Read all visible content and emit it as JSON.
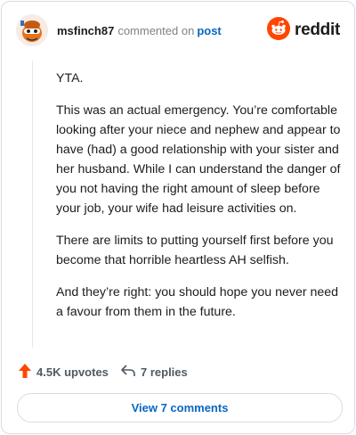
{
  "header": {
    "username": "msfinch87",
    "action_text": "commented on",
    "post_link": "post",
    "brand": "reddit"
  },
  "comment": {
    "paragraphs": [
      "YTA.",
      "This was an actual emergency. You’re comfortable looking after your niece and nephew and appear to have (had) a good relationship with your sister and her husband. While I can understand the danger of you not having the right amount of sleep before your job, your wife had leisure activities on.",
      "There are limits to putting yourself first before you become that horrible heartless AH selfish.",
      "And they’re right: you should hope you never need a favour from them in the future."
    ]
  },
  "actions": {
    "upvotes": "4.5K upvotes",
    "replies": "7 replies"
  },
  "footer": {
    "view_comments": "View 7 comments"
  },
  "colors": {
    "accent_orange": "#ff4500",
    "link_blue": "#0a66c2"
  },
  "icons": [
    "avatar",
    "reddit-logo-icon",
    "upvote-arrow-icon",
    "reply-arrow-icon"
  ]
}
